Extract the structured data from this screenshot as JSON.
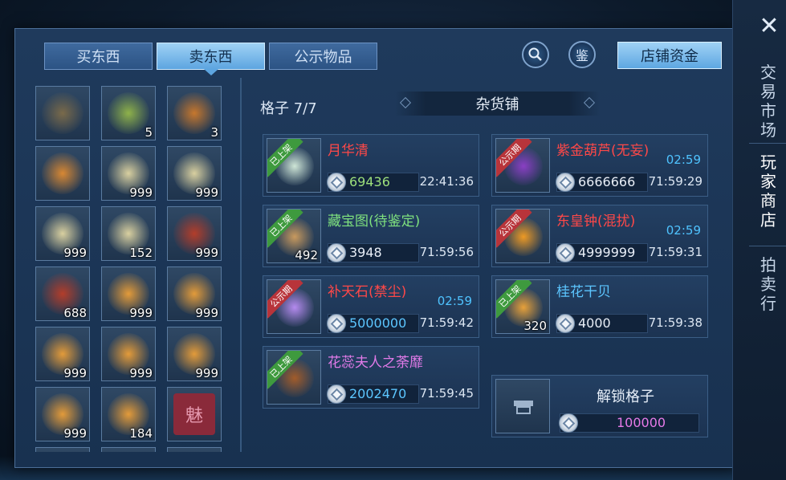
{
  "tabs": [
    {
      "label": "买东西",
      "active": false
    },
    {
      "label": "卖东西",
      "active": true
    },
    {
      "label": "公示物品",
      "active": false
    }
  ],
  "toolbar": {
    "search_icon": "magnifier-icon",
    "appraise_label": "鉴",
    "fund_label": "店铺资金"
  },
  "inventory": [
    {
      "icon": "bundle-icon",
      "count": "",
      "color": "#7a6a4a"
    },
    {
      "icon": "gourd-green-icon",
      "count": "5",
      "color": "#8fb24a"
    },
    {
      "icon": "gourd-orange-icon",
      "count": "3",
      "color": "#c7772d"
    },
    {
      "icon": "gourd-orange-icon",
      "count": "",
      "color": "#d88833"
    },
    {
      "icon": "soup-bowl-icon",
      "count": "999",
      "color": "#d9d0a0"
    },
    {
      "icon": "soup-bowl-icon",
      "count": "999",
      "color": "#d9d0a0"
    },
    {
      "icon": "soup-bowl-icon",
      "count": "999",
      "color": "#d9d0a0"
    },
    {
      "icon": "soup-bowl-icon",
      "count": "152",
      "color": "#d9d0a0"
    },
    {
      "icon": "meat-plate-icon",
      "count": "999",
      "color": "#b33d2a"
    },
    {
      "icon": "meat-plate-icon",
      "count": "688",
      "color": "#b33d2a"
    },
    {
      "icon": "stew-jar-icon",
      "count": "999",
      "color": "#e39b3a"
    },
    {
      "icon": "stew-jar-icon",
      "count": "999",
      "color": "#e39b3a"
    },
    {
      "icon": "stew-jar-icon",
      "count": "999",
      "color": "#e39b3a"
    },
    {
      "icon": "stew-jar-icon",
      "count": "999",
      "color": "#e39b3a"
    },
    {
      "icon": "stew-jar-icon",
      "count": "999",
      "color": "#e39b3a"
    },
    {
      "icon": "stew-jar-icon",
      "count": "999",
      "color": "#e39b3a"
    },
    {
      "icon": "stew-jar-icon",
      "count": "184",
      "color": "#e39b3a"
    },
    {
      "icon": "charm-book-icon",
      "count": "",
      "color": "#8a2a3a",
      "glyph": "魅"
    }
  ],
  "shop": {
    "slot_count": "格子 7/7",
    "name": "杂货铺"
  },
  "listings": [
    {
      "name": "月华清",
      "name_color": "#ff4848",
      "badge": "已上架",
      "badge_type": "green",
      "icon": "perfume-bottle-icon",
      "icon_color": "#cfe6d7",
      "count": "",
      "price": "69436",
      "price_color": "#9de07c",
      "timer": "22:41:36",
      "sub_timer": ""
    },
    {
      "name": "紫金葫芦(无妄)",
      "name_color": "#ff4848",
      "badge": "公示期",
      "badge_type": "red",
      "icon": "purple-gourd-icon",
      "icon_color": "#8a3fc4",
      "count": "",
      "price": "6666666",
      "price_color": "#e8eef7",
      "timer": "71:59:29",
      "sub_timer": "02:59"
    },
    {
      "name": "藏宝图(待鉴定)",
      "name_color": "#7ee07e",
      "badge": "已上架",
      "badge_type": "green",
      "icon": "treasure-map-icon",
      "icon_color": "#c99a5e",
      "count": "492",
      "price": "3948",
      "price_color": "#e8eef7",
      "timer": "71:59:56",
      "sub_timer": ""
    },
    {
      "name": "东皇钟(混扰)",
      "name_color": "#ff4848",
      "badge": "公示期",
      "badge_type": "red",
      "icon": "golden-bell-icon",
      "icon_color": "#ee9a24",
      "count": "",
      "price": "4999999",
      "price_color": "#e8eef7",
      "timer": "71:59:31",
      "sub_timer": "02:59"
    },
    {
      "name": "补天石(禁尘)",
      "name_color": "#ff4848",
      "badge": "公示期",
      "badge_type": "red",
      "icon": "crystal-icon",
      "icon_color": "#b58bef",
      "count": "",
      "price": "5000000",
      "price_color": "#5cc6ff",
      "timer": "71:59:42",
      "sub_timer": "02:59"
    },
    {
      "name": "桂花干贝",
      "name_color": "#5cc6ff",
      "badge": "已上架",
      "badge_type": "green",
      "icon": "scallop-dish-icon",
      "icon_color": "#e7a13a",
      "count": "320",
      "price": "4000",
      "price_color": "#e8eef7",
      "timer": "71:59:38",
      "sub_timer": ""
    },
    {
      "name": "花蕊夫人之荼靡",
      "name_color": "#e07ae8",
      "badge": "已上架",
      "badge_type": "green",
      "icon": "belt-icon",
      "icon_color": "#a25c2a",
      "count": "",
      "price": "2002470",
      "price_color": "#5cc6ff",
      "timer": "71:59:45",
      "sub_timer": ""
    }
  ],
  "unlock": {
    "label": "解锁格子",
    "price": "100000",
    "price_color": "#e67ae8",
    "icon": "locked-stall-icon"
  },
  "side_nav": {
    "close_icon": "close-icon",
    "items": [
      {
        "label": "交易市场",
        "active": false
      },
      {
        "label": "玩家商店",
        "active": true
      },
      {
        "label": "拍卖行",
        "active": false
      }
    ]
  }
}
